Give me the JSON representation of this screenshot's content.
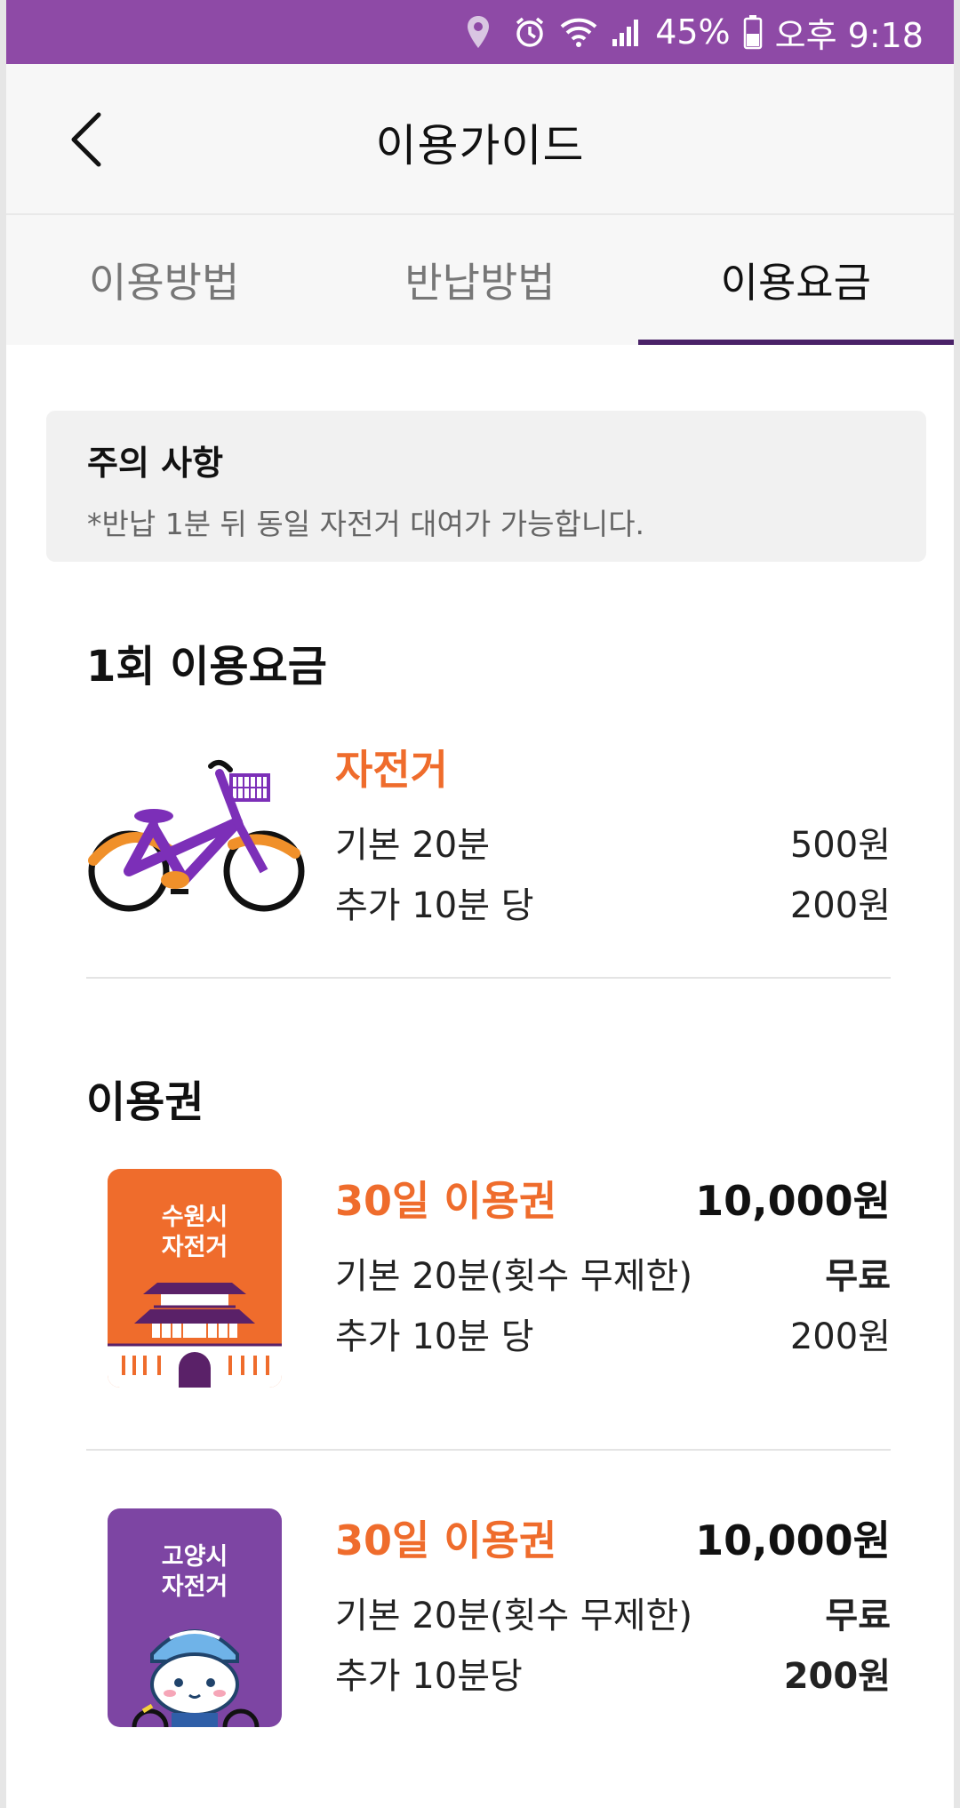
{
  "status_bar": {
    "battery": "45%",
    "time": "오후 9:18"
  },
  "header": {
    "title": "이용가이드"
  },
  "tabs": [
    {
      "label": "이용방법",
      "active": false
    },
    {
      "label": "반납방법",
      "active": false
    },
    {
      "label": "이용요금",
      "active": true
    }
  ],
  "notice": {
    "title": "주의 사항",
    "text": "*반납 1분 뒤 동일 자전거 대여가 가능합니다."
  },
  "single_fee": {
    "section_title": "1회 이용요금",
    "item_title": "자전거",
    "lines": [
      {
        "label": "기본 20분",
        "value": "500원"
      },
      {
        "label": "추가 10분 당",
        "value": "200원"
      }
    ]
  },
  "passes": {
    "section_title": "이용권",
    "items": [
      {
        "card_line1": "수원시",
        "card_line2": "자전거",
        "title": "30일 이용권",
        "price": "10,000원",
        "lines": [
          {
            "label": "기본 20분(횟수 무제한)",
            "value": "무료"
          },
          {
            "label": "추가 10분 당",
            "value": "200원"
          }
        ]
      },
      {
        "card_line1": "고양시",
        "card_line2": "자전거",
        "title": "30일 이용권",
        "price": "10,000원",
        "lines": [
          {
            "label": "기본 20분(횟수 무제한)",
            "value": "무료"
          },
          {
            "label": "추가 10분당",
            "value": "200원"
          }
        ]
      }
    ]
  },
  "colors": {
    "status_bar": "#8e4aa6",
    "accent_orange": "#ef6c2c",
    "tab_indicator": "#4a2268",
    "suwon_card": "#ef6c2c",
    "goyang_card": "#7d45a3"
  },
  "icons": {
    "back": "chevron-left-icon",
    "location": "location-icon",
    "alarm": "alarm-icon",
    "wifi": "wifi-icon",
    "signal": "signal-icon",
    "battery": "battery-icon",
    "bike": "bicycle-icon"
  }
}
